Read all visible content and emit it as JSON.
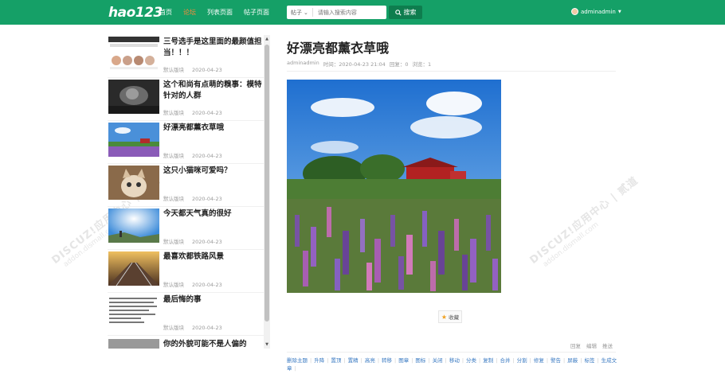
{
  "header": {
    "logo": "hao123",
    "nav": [
      "首页",
      "论坛",
      "列表页面",
      "帖子页面"
    ],
    "search_type": "帖子",
    "search_placeholder": "请输入搜索内容",
    "search_button": "搜索",
    "username": "adminadmin"
  },
  "sidebar": {
    "items": [
      {
        "title": "三号选手是这里面的最颜值担当！！！",
        "forum": "默认版块",
        "date": "2020-04-23"
      },
      {
        "title": "这个和尚有点萌的糗事：模特针对的人群",
        "forum": "默认版块",
        "date": "2020-04-23"
      },
      {
        "title": "好漂亮都薰衣草哦",
        "forum": "默认版块",
        "date": "2020-04-23"
      },
      {
        "title": "这只小猫咪可爱吗？",
        "forum": "默认版块",
        "date": "2020-04-23"
      },
      {
        "title": "今天都天气真的很好",
        "forum": "默认版块",
        "date": "2020-04-23"
      },
      {
        "title": "最喜欢都铁路风景",
        "forum": "默认版块",
        "date": "2020-04-23"
      },
      {
        "title": "最后悔的事",
        "forum": "默认版块",
        "date": "2020-04-23"
      },
      {
        "title": "你的外貌可能不是人偏的",
        "forum": "",
        "date": ""
      }
    ]
  },
  "article": {
    "title": "好漂亮都薰衣草哦",
    "author": "adminadmin",
    "time_label": "时间：2020-04-23 21:04",
    "replies_label": "回复：0",
    "views_label": "浏览：1",
    "favorite": "收藏",
    "actions": [
      "回复",
      "编辑",
      "推送"
    ],
    "mod_links": [
      "删除主题",
      "升降",
      "置顶",
      "置精",
      "高亮",
      "转移",
      "图章",
      "图标",
      "关闭",
      "移动",
      "分类",
      "复制",
      "合并",
      "分割",
      "修复",
      "警告",
      "屏蔽",
      "标签",
      "生成文章"
    ]
  },
  "watermark": {
    "text": "DISCUZ!应用中心 | 贰道",
    "sub": "addon.dismall.com"
  },
  "colors": {
    "header_bg": "#15a067",
    "active_nav": "#ff8a3a",
    "link": "#3a7ac2"
  }
}
